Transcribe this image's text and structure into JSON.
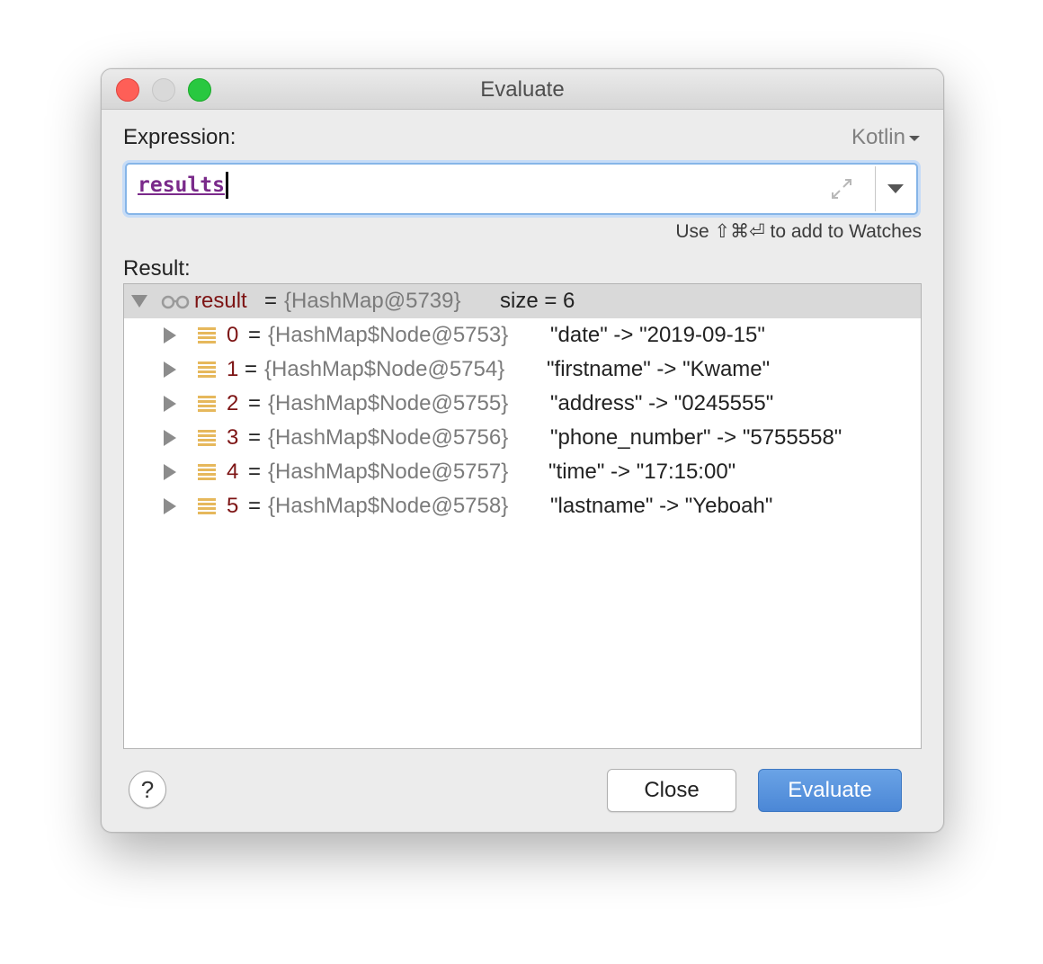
{
  "window": {
    "title": "Evaluate"
  },
  "expression": {
    "label": "Expression:",
    "language": "Kotlin",
    "value": "results",
    "hint": "Use ⇧⌘⏎ to add to Watches"
  },
  "result": {
    "label": "Result:",
    "root": {
      "name": "result",
      "eq": "=",
      "value": "{HashMap@5739}",
      "size": "size = 6"
    },
    "children": [
      {
        "index": "0",
        "eq": "=",
        "node": "{HashMap$Node@5753}",
        "text": "\"date\" -> \"2019-09-15\""
      },
      {
        "index": "1",
        "eq": "=",
        "node": "{HashMap$Node@5754}",
        "text": "\"firstname\" -> \"Kwame\""
      },
      {
        "index": "2",
        "eq": "=",
        "node": "{HashMap$Node@5755}",
        "text": "\"address\" -> \"0245555\""
      },
      {
        "index": "3",
        "eq": "=",
        "node": "{HashMap$Node@5756}",
        "text": "\"phone_number\" -> \"5755558\""
      },
      {
        "index": "4",
        "eq": "=",
        "node": "{HashMap$Node@5757}",
        "text": "\"time\" -> \"17:15:00\""
      },
      {
        "index": "5",
        "eq": "=",
        "node": "{HashMap$Node@5758}",
        "text": "\"lastname\" -> \"Yeboah\""
      }
    ]
  },
  "buttons": {
    "help": "?",
    "close": "Close",
    "evaluate": "Evaluate"
  },
  "icons": {
    "expand": "expand-icon",
    "history": "chevron-down-icon",
    "watch": "glasses-icon",
    "entry": "entry-icon"
  },
  "colors": {
    "accent": "#4b87d6",
    "focus_ring": "#86b5e8",
    "name_red": "#7d1414",
    "type_gray": "#7b7b7b",
    "keyword_purple": "#7a2a8a"
  }
}
